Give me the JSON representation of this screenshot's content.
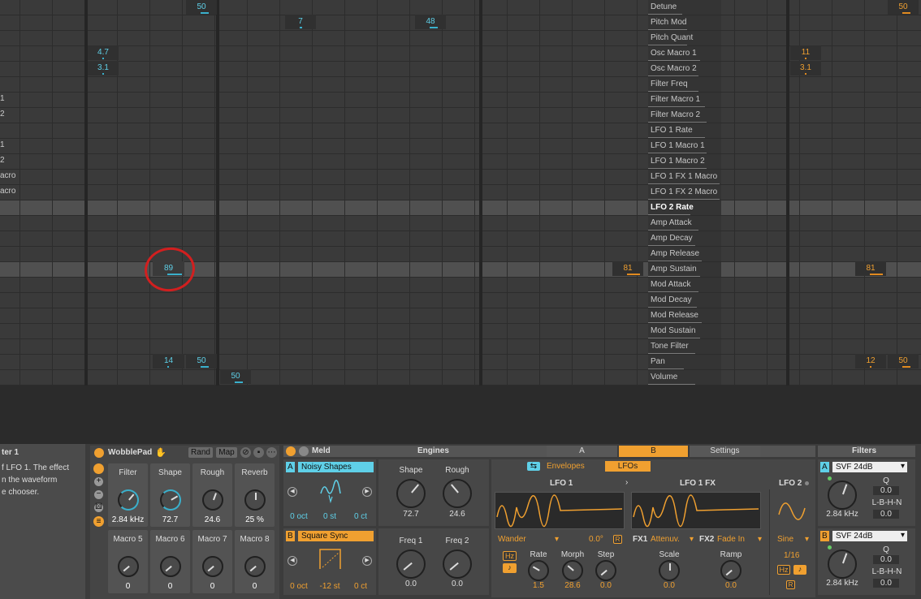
{
  "params": [
    "Detune",
    "Pitch Mod",
    "Pitch Quant",
    "Osc Macro 1",
    "Osc Macro 2",
    "Filter Freq",
    "Filter Macro 1",
    "Filter Macro 2",
    "LFO 1 Rate",
    "LFO 1 Macro 1",
    "LFO 1 Macro 2",
    "LFO 1 FX 1 Macro",
    "LFO 1 FX 2 Macro",
    "LFO 2 Rate",
    "Amp Attack",
    "Amp Decay",
    "Amp Release",
    "Amp Sustain",
    "Mod Attack",
    "Mod Decay",
    "Mod Release",
    "Mod Sustain",
    "Tone Filter",
    "Pan",
    "Volume"
  ],
  "selected_param": "LFO 2 Rate",
  "left_fragments": [
    "1",
    "2",
    "1",
    "2",
    "acro",
    "acro"
  ],
  "grid_values": {
    "v_50a": "50",
    "v_7": "7",
    "v_48": "48",
    "v_4_7": "4.7",
    "v_3_1": "3.1",
    "v_89": "89",
    "v_81": "81",
    "v_14": "14",
    "v_50b": "50",
    "v_50c": "50",
    "r_50": "50",
    "r_11": "11",
    "r_3_1": "3.1",
    "r_81": "81",
    "r_12": "12",
    "r_50b": "50"
  },
  "info": {
    "title": "ter 1",
    "text": [
      "f LFO 1. The effect",
      "n the waveform",
      "e chooser."
    ]
  },
  "rack": {
    "name": "WobblePad",
    "rand": "Rand",
    "map": "Map",
    "macros": [
      {
        "label": "Filter",
        "value": "2.84 kHz"
      },
      {
        "label": "Shape",
        "value": "72.7"
      },
      {
        "label": "Rough",
        "value": "24.6"
      },
      {
        "label": "Reverb",
        "value": "25 %"
      },
      {
        "label": "Macro 5",
        "value": "0"
      },
      {
        "label": "Macro 6",
        "value": "0"
      },
      {
        "label": "Macro 7",
        "value": "0"
      },
      {
        "label": "Macro 8",
        "value": "0"
      }
    ]
  },
  "meld": {
    "name": "Meld",
    "engines_label": "Engines",
    "tab_a": "A",
    "tab_b": "B",
    "tab_settings": "Settings",
    "engine_a": {
      "badge": "A",
      "shape": "Noisy Shapes",
      "oct": "0 oct",
      "st": "0 st",
      "ct": "0 ct"
    },
    "engine_b": {
      "badge": "B",
      "shape": "Square Sync",
      "oct": "0 oct",
      "st": "-12 st",
      "ct": "0 ct"
    },
    "shape_label": "Shape",
    "shape_value": "72.7",
    "rough_label": "Rough",
    "rough_value": "24.6",
    "freq1_label": "Freq 1",
    "freq1_value": "0.0",
    "freq2_label": "Freq 2",
    "freq2_value": "0.0",
    "envelopes": "Envelopes",
    "lfos": "LFOs",
    "lfo1": "LFO 1",
    "lfo1fx": "LFO 1 FX",
    "lfo2": "LFO 2",
    "wander": "Wander",
    "phase": "0.0°",
    "r": "R",
    "fx1": "FX1",
    "fx1_mode": "Attenuv.",
    "fx2": "FX2",
    "fx2_mode": "Fade In",
    "rate_label": "Rate",
    "rate_value": "1.5",
    "morph_label": "Morph",
    "morph_value": "28.6",
    "step_label": "Step",
    "step_value": "0.0",
    "scale_label": "Scale",
    "scale_value": "0.0",
    "ramp_label": "Ramp",
    "ramp_value": "0.0",
    "hz": "Hz",
    "sine": "Sine",
    "lfo2_rate": "1/16"
  },
  "filters": {
    "title": "Filters",
    "a": {
      "badge": "A",
      "type": "SVF 24dB",
      "freq": "2.84 kHz",
      "q_label": "Q",
      "q": "0.0",
      "mode": "L-B-H-N",
      "mode_val": "0.0"
    },
    "b": {
      "badge": "B",
      "type": "SVF 24dB",
      "freq": "2.84 kHz",
      "q_label": "Q",
      "q": "0.0",
      "mode": "L-B-H-N",
      "mode_val": "0.0"
    }
  },
  "colors": {
    "cyan": "#5fd0e8",
    "orange": "#f0a030",
    "annotation": "#d21f1f"
  }
}
